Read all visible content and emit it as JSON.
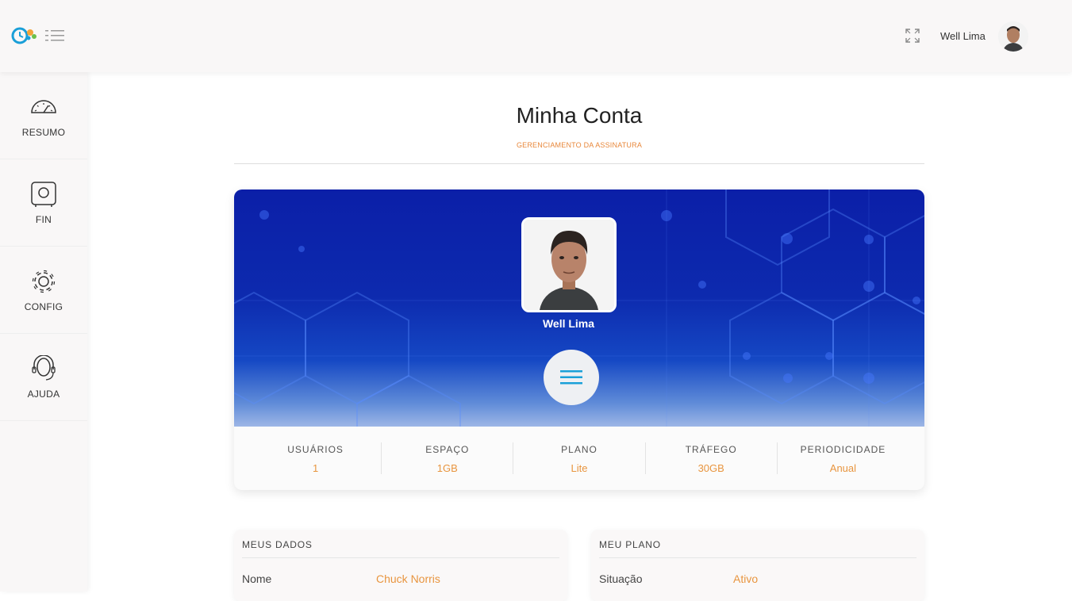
{
  "header": {
    "logo_icon": "clock-gear-logo",
    "menu_icon": "hamburger-menu-icon",
    "fullscreen_icon": "fullscreen-icon",
    "username": "Well Lima"
  },
  "sidebar": {
    "items": [
      {
        "label": "RESUMO",
        "icon": "speedometer-icon"
      },
      {
        "label": "FIN",
        "icon": "safe-icon"
      },
      {
        "label": "CONFIG",
        "icon": "gear-icon"
      },
      {
        "label": "AJUDA",
        "icon": "headset-icon"
      }
    ]
  },
  "page": {
    "title": "Minha Conta",
    "subtitle": "GERENCIAMENTO DA ASSINATURA"
  },
  "profile": {
    "name": "Well Lima",
    "menu_icon": "hamburger-menu-icon"
  },
  "stats": [
    {
      "label": "USUÁRIOS",
      "value": "1"
    },
    {
      "label": "ESPAÇO",
      "value": "1GB"
    },
    {
      "label": "PLANO",
      "value": "Lite"
    },
    {
      "label": "TRÁFEGO",
      "value": "30GB"
    },
    {
      "label": "PERIODICIDADE",
      "value": "Anual"
    }
  ],
  "my_data": {
    "title": "MEUS DADOS",
    "rows": [
      {
        "key": "Nome",
        "value": "Chuck Norris"
      }
    ]
  },
  "my_plan": {
    "title": "MEU PLANO",
    "rows": [
      {
        "key": "Situação",
        "value": "Ativo"
      }
    ]
  },
  "colors": {
    "accent": "#e8953f",
    "banner_blue": "#0d2aae",
    "menu_icon_blue": "#1aa0d8"
  }
}
